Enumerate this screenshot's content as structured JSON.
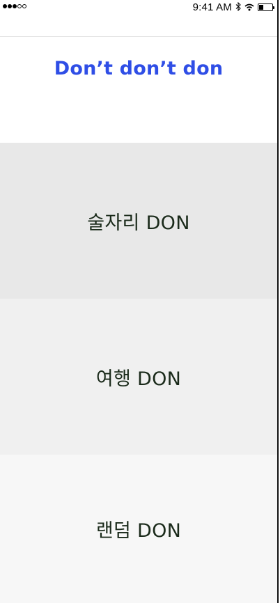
{
  "status_bar": {
    "signal_dots": [
      "filled",
      "filled",
      "filled",
      "empty",
      "empty"
    ],
    "time": "9:41 AM",
    "bluetooth_icon": "bluetooth-icon",
    "wifi_icon": "wifi-icon",
    "battery_level": 0.35
  },
  "header": {
    "title": "Don’t don’t don",
    "title_color": "#2f4ee6"
  },
  "categories": [
    {
      "label": "술자리 DON",
      "background": "#e8e8e8"
    },
    {
      "label": "여행 DON",
      "background": "#f0f0f0"
    },
    {
      "label": "랜덤 DON",
      "background": "#f7f7f7"
    }
  ]
}
